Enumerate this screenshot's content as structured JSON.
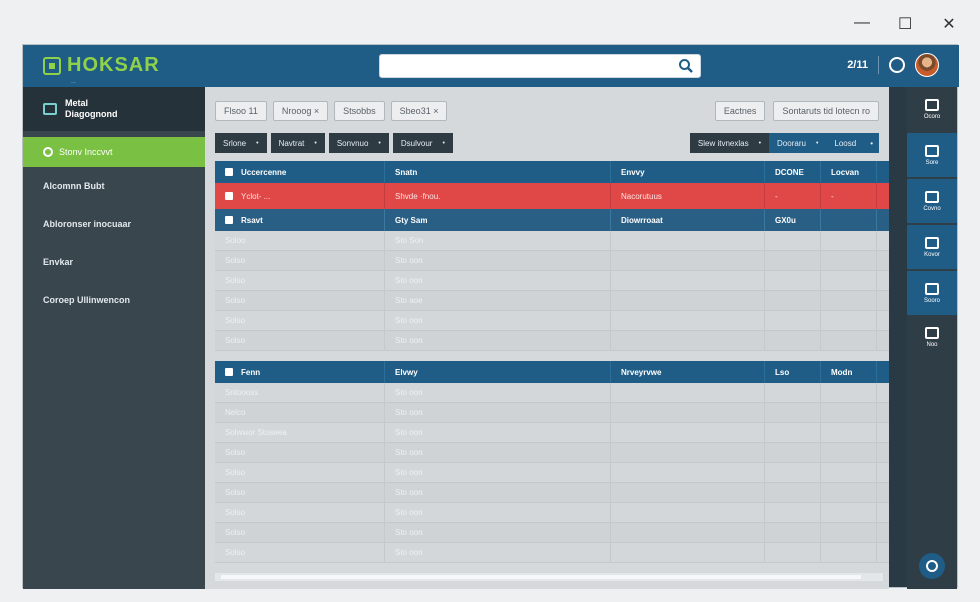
{
  "window_controls": {
    "minimize": "—",
    "maximize": "☐",
    "close": "✕"
  },
  "brand": {
    "name": "HOKSAR",
    "tagline": "…"
  },
  "header": {
    "count": "2/11",
    "search_placeholder": ""
  },
  "sidebar": {
    "header": [
      "Metal",
      "Diagognond"
    ],
    "active": "Stonv Inccvvt",
    "items": [
      "Alcomnn Bubt",
      "Abloronser inocuaar",
      "Envkar",
      "Coroep Ullinwencon"
    ]
  },
  "filters": {
    "left": [
      "Flsoo  11",
      "Nrooog  ×",
      "Stsobbs",
      "Sbeo31  ×"
    ],
    "right": [
      "Eactnes",
      "Sontaruts tid lotecn ro"
    ]
  },
  "dropdowns": {
    "left": [
      "Srlone",
      "Navtrat",
      "Sonvnuo",
      "Dsulvour"
    ],
    "right": [
      "Slew itvnexlas",
      "Dooraru",
      "Loosd",
      "•"
    ]
  },
  "table1": {
    "header": [
      "Uccercenne",
      "Snatn",
      "Envvy",
      "DCONE",
      "Locvan"
    ],
    "highlight": [
      "Yclot- ...",
      "Shvde ·fnou.",
      "Nacorutuus",
      "-",
      "-"
    ],
    "subheader": [
      "Rsavt",
      "Gty Sam",
      "Diowrroaat",
      "GX0u",
      ""
    ],
    "rows": [
      [
        "Soloo",
        "Sto Son"
      ],
      [
        "Solso",
        "Sto oon"
      ],
      [
        "Solso",
        "Sto oon"
      ],
      [
        "Solso",
        "Sto aoe"
      ],
      [
        "Solso",
        "Sto oon"
      ],
      [
        "Solso",
        "Sto oon"
      ]
    ]
  },
  "table2": {
    "header": [
      "Fenn",
      "Elvwy",
      "Nrveyrvwe",
      "Lso",
      "Modn"
    ],
    "rows": [
      [
        "Sntoooss",
        "Sto oon"
      ],
      [
        "Nelco",
        "Sto oon"
      ],
      [
        "Solwwor Stoseea",
        "Sto oon"
      ],
      [
        "Solso",
        "Sto oon"
      ],
      [
        "Solso",
        "Sto oon"
      ],
      [
        "Solso",
        "Sto oon"
      ],
      [
        "Solso",
        "Sto oon"
      ],
      [
        "Solso",
        "Sto oon"
      ],
      [
        "Solso",
        "Sto oon"
      ]
    ]
  },
  "rail": [
    "Ocoro",
    "Sore",
    "Covno",
    "Kovor",
    "Sooro",
    "Noo"
  ],
  "colors": {
    "accent": "#1f5d87",
    "active": "#7ac143",
    "alert": "#e04848",
    "sidebar": "#3a464e"
  }
}
